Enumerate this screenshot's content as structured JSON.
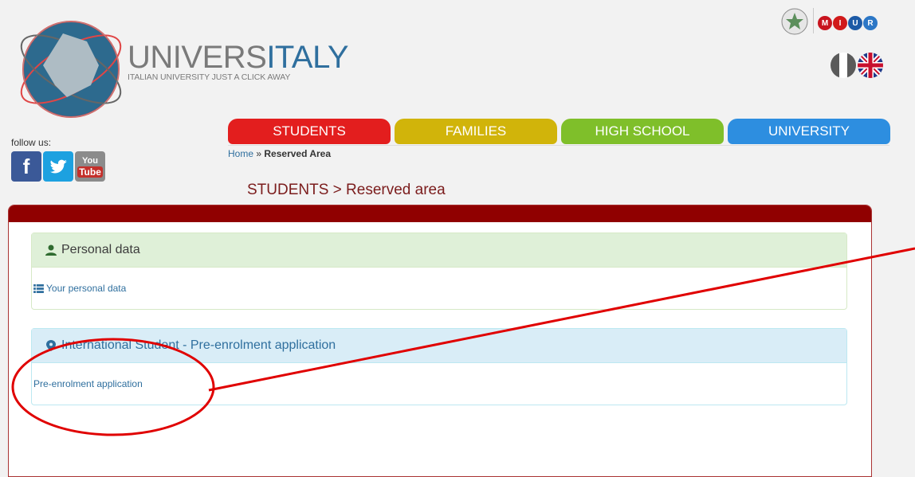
{
  "brand": {
    "title_part1": "UNIVERS",
    "title_part2": "ITALY",
    "tagline": "ITALIAN UNIVERSITY JUST A CLICK AWAY"
  },
  "top_logos": {
    "miur_letters": [
      "M",
      "I",
      "U",
      "R"
    ]
  },
  "follow_us_label": "follow us:",
  "social": {
    "facebook": "f",
    "youtube_top": "You",
    "youtube_bottom": "Tube"
  },
  "nav": {
    "tabs": [
      {
        "label": "STUDENTS",
        "color": "#e31e1e"
      },
      {
        "label": "FAMILIES",
        "color": "#d1b40a"
      },
      {
        "label": "HIGH SCHOOL",
        "color": "#7fbf2a"
      },
      {
        "label": "UNIVERSITY",
        "color": "#2d8ee0"
      }
    ]
  },
  "breadcrumb": {
    "home": "Home",
    "sep": "»",
    "current": "Reserved Area"
  },
  "page_title": "STUDENTS > Reserved area",
  "personal": {
    "title": "Personal data",
    "link": "Your personal data"
  },
  "international": {
    "title": "International Student - Pre-enrolment application",
    "link": "Pre-enrolment application"
  },
  "annotation_color": "#e00000"
}
